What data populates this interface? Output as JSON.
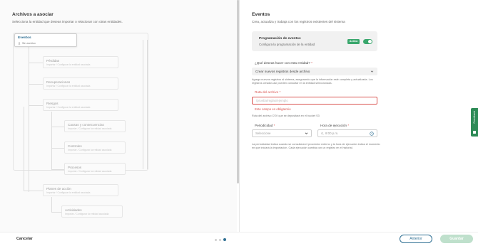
{
  "left": {
    "title": "Archivos a asociar",
    "subtitle": "Selecciona la entidad que deseas importar o relacionar con otras entidades.",
    "root": {
      "title": "Eventos",
      "sub": "Sin archivo"
    },
    "nodes": [
      {
        "title": "Pérdidas",
        "sub": "Importar / Configurar la entidad asociada"
      },
      {
        "title": "Recuperaciones",
        "sub": "Importar / Configurar la entidad asociada"
      },
      {
        "title": "Riesgos",
        "sub": "Importar / Configurar la entidad asociada"
      },
      {
        "title": "Causas y consecuencias",
        "sub": "Importar / Configurar la entidad asociada"
      },
      {
        "title": "Controles",
        "sub": "Importar / Configurar la entidad asociada"
      },
      {
        "title": "Procesos",
        "sub": "Importar / Configurar la entidad asociada"
      },
      {
        "title": "Planes de acción",
        "sub": "Importar / Configurar la entidad asociada"
      },
      {
        "title": "Actividades",
        "sub": "Importar / Configurar la entidad asociada"
      }
    ]
  },
  "right": {
    "title": "Eventos",
    "subtitle": "Crea, actualiza y trabaja con los registros existentes del sistema",
    "programming": {
      "title": "Programación de eventos",
      "sub": "Configura la programación de la entidad",
      "badge": "Activa",
      "enabled": true
    },
    "action_label": "¿Qué deseas hacer con esta entidad?",
    "action_value": "Crear nuevos registros desde archivo",
    "action_help": "Agrega nuevos registros al sistema, asegurando que la información esté completa y actualizada. Los registros creados así pueden consultar en la entidad seleccionada.",
    "path_label": "Ruta del archivo",
    "path_placeholder": "/prueba/reglas/ejemplo",
    "path_error": "Este campo es obligatorio",
    "path_help": "Ruta del archivo CSV que se depositará en el bucket S3",
    "periodicity_label": "Periodicidad",
    "periodicity_value": "Seleccione",
    "time_label": "Hora de ejecución",
    "time_placeholder": "8:00 p.m.",
    "schedule_help": "La periodicidad indica cuando se consultará el proveedor externo y la hora de ejecución indica el momento en que iniciará la importación. Cada ejecución cambia con un registro en el historial.",
    "required_mark": "*"
  },
  "feedback": "Feedback",
  "footer": {
    "cancel": "Cancelar",
    "prev": "Anterior",
    "save": "Guardar",
    "steps_total": 3,
    "step_current": 3
  },
  "colors": {
    "accent": "#2f6f93",
    "success": "#3aa76d",
    "error": "#d9534f"
  }
}
